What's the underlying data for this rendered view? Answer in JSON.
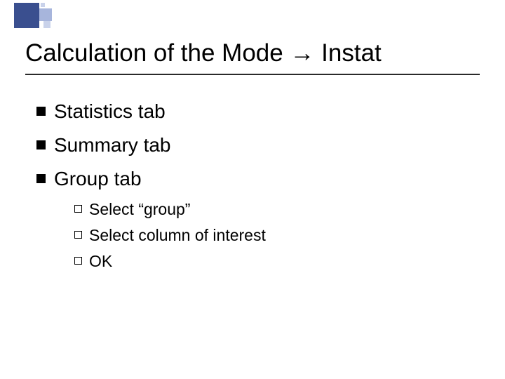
{
  "title": {
    "prefix": "Calculation of the Mode ",
    "arrow": "→",
    "suffix": " Instat"
  },
  "bullets": [
    {
      "text": "Statistics tab"
    },
    {
      "text": "Summary tab"
    },
    {
      "text": "Group tab"
    }
  ],
  "subbullets": [
    {
      "text": "Select “group”"
    },
    {
      "text": "Select column of interest"
    },
    {
      "text": "OK"
    }
  ]
}
